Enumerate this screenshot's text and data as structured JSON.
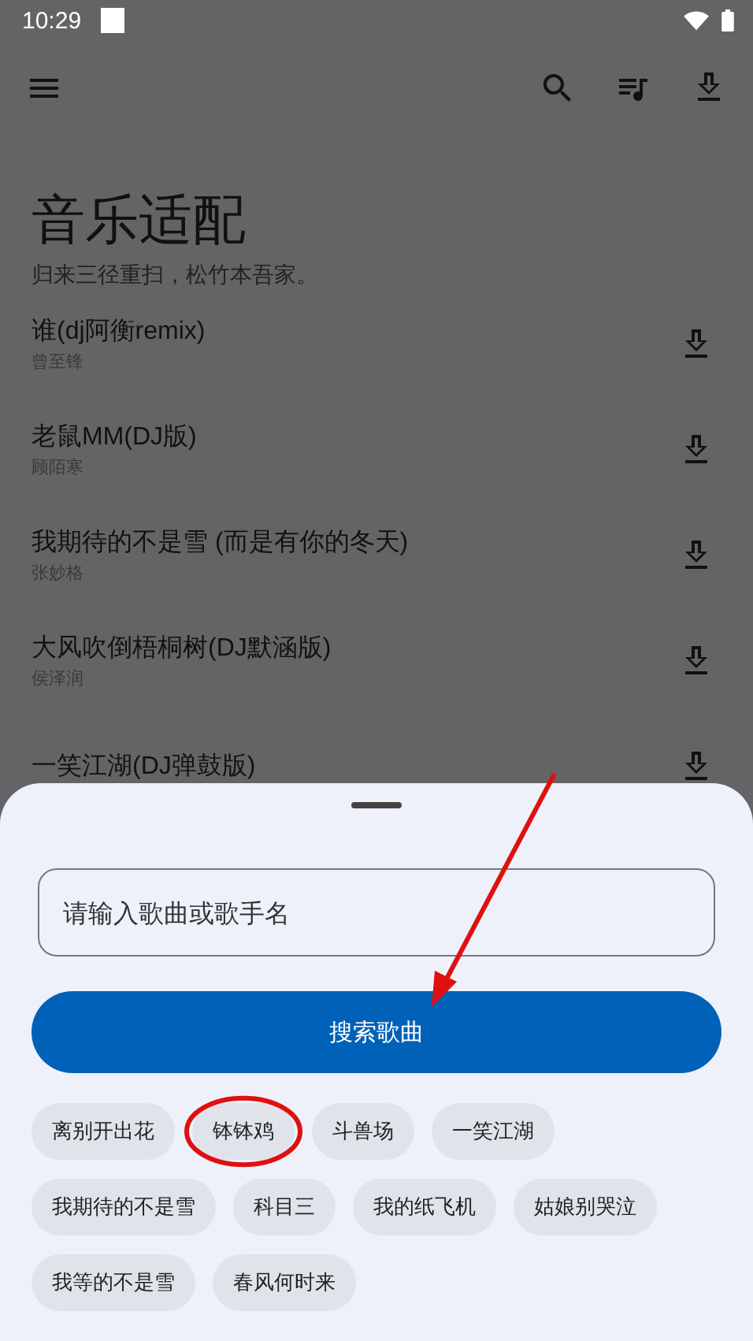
{
  "status_bar": {
    "time": "10:29"
  },
  "app_bar": {
    "actions": [
      {
        "kind": "search"
      },
      {
        "kind": "playlist"
      },
      {
        "kind": "download"
      }
    ]
  },
  "header": {
    "title": "音乐适配",
    "subtitle": "归来三径重扫，松竹本吾家。"
  },
  "songs": [
    {
      "title": "谁(dj阿衡remix)",
      "artist": "曾至锋"
    },
    {
      "title": "老鼠MM(DJ版)",
      "artist": "顾陌寒"
    },
    {
      "title": "我期待的不是雪 (而是有你的冬天)",
      "artist": "张妙格"
    },
    {
      "title": "大风吹倒梧桐树(DJ默涵版)",
      "artist": "侯泽润"
    },
    {
      "title": "一笑江湖(DJ弹鼓版)"
    }
  ],
  "search_sheet": {
    "placeholder": "请输入歌曲或歌手名",
    "button": {
      "label": "搜索歌曲",
      "arrow_pointed": true
    },
    "suggestions": [
      {
        "label": "离别开出花",
        "circled": false
      },
      {
        "label": "钵钵鸡",
        "circled": true
      },
      {
        "label": "斗兽场",
        "circled": false
      },
      {
        "label": "一笑江湖",
        "circled": false
      },
      {
        "label": "我期待的不是雪",
        "circled": false
      },
      {
        "label": "科目三",
        "circled": false
      },
      {
        "label": "我的纸飞机",
        "circled": false
      },
      {
        "label": "姑娘别哭泣",
        "circled": false
      },
      {
        "label": "我等的不是雪",
        "circled": false
      },
      {
        "label": "春风何时来",
        "circled": false
      }
    ]
  }
}
